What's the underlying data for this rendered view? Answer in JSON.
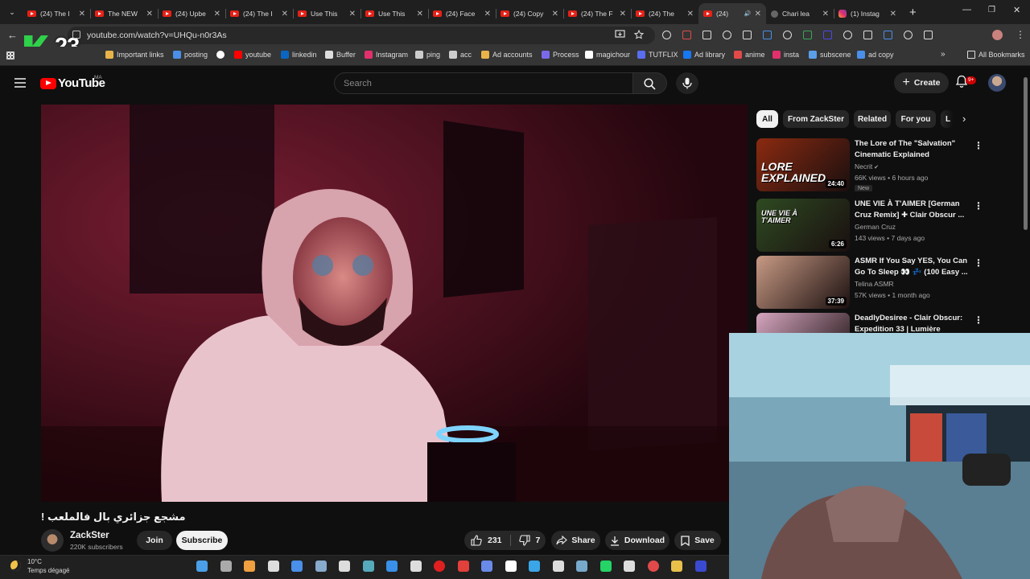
{
  "browser": {
    "tabs": [
      {
        "title": "(24) The I",
        "type": "yt"
      },
      {
        "title": "The NEW",
        "type": "yt"
      },
      {
        "title": "(24) Upbe",
        "type": "yt"
      },
      {
        "title": "(24) The I",
        "type": "yt"
      },
      {
        "title": "Use This",
        "type": "yt"
      },
      {
        "title": "Use This",
        "type": "yt"
      },
      {
        "title": "(24) Face",
        "type": "yt"
      },
      {
        "title": "(24) Copy",
        "type": "yt"
      },
      {
        "title": "(24) The F",
        "type": "yt"
      },
      {
        "title": "(24) The ",
        "type": "yt"
      },
      {
        "title": "(24)",
        "type": "yt",
        "active": true
      },
      {
        "title": "Chari lea",
        "type": "ch"
      },
      {
        "title": "(1) Instag",
        "type": "ig"
      }
    ],
    "url": "youtube.com/watch?v=UHQu-n0r3As",
    "overlay_number": "23",
    "bookmarks": [
      {
        "label": "Important links",
        "color": "#e8b44a"
      },
      {
        "label": "posting",
        "color": "#4a8fe8"
      },
      {
        "label": "",
        "color": "#ffffff"
      },
      {
        "label": "youtube",
        "color": "#ff0000"
      },
      {
        "label": "linkedin",
        "color": "#0a66c2"
      },
      {
        "label": "Buffer",
        "color": "#dddddd"
      },
      {
        "label": "Instagram",
        "color": "#e1306c"
      },
      {
        "label": "ping",
        "color": "#cccccc"
      },
      {
        "label": "acc",
        "color": "#cccccc"
      },
      {
        "label": "Ad accounts",
        "color": "#e8b44a"
      },
      {
        "label": "Process",
        "color": "#7a6ae8"
      },
      {
        "label": "magichour",
        "color": "#ffffff"
      },
      {
        "label": "TUTFLIX",
        "color": "#5a6ef0"
      },
      {
        "label": "Ad library",
        "color": "#1877f2"
      },
      {
        "label": "anime",
        "color": "#e24a4a"
      },
      {
        "label": "insta",
        "color": "#e1306c"
      },
      {
        "label": "subscene",
        "color": "#5a9fe8"
      },
      {
        "label": "ad copy",
        "color": "#4a8fe8"
      }
    ],
    "all_bookmarks": "All Bookmarks"
  },
  "youtube": {
    "logo_text": "YouTube",
    "country_code": "MA",
    "search_placeholder": "Search",
    "create_label": "Create",
    "notif_badge": "9+"
  },
  "video": {
    "title": "! مشجع جزائري بال فالملعب",
    "channel": "ZackSter",
    "subscribers": "220K subscribers",
    "join_label": "Join",
    "subscribe_label": "Subscribe",
    "likes": "231",
    "dislikes": "7",
    "share_label": "Share",
    "download_label": "Download",
    "save_label": "Save"
  },
  "chips": [
    "All",
    "From ZackSter",
    "Related",
    "For you",
    "L"
  ],
  "related": [
    {
      "title": "The Lore of The \"Salvation\" Cinematic Explained",
      "channel": "Necrit",
      "verified": true,
      "views": "66K views • 6 hours ago",
      "duration": "24:40",
      "badge": "New",
      "thumb_text": "LORE EXPLAINED",
      "color": "#8b2a10"
    },
    {
      "title": "UNE VIE À T'AIMER [German Cruz Remix] ✚ Clair Obscur ...",
      "channel": "German Cruz",
      "verified": false,
      "views": "143 views • 7 days ago",
      "duration": "6:26",
      "thumb_text": "UNE VIE À T'AIMER",
      "color": "#2e4a22"
    },
    {
      "title": "ASMR If You Say YES, You Can Go To Sleep 👀 💤 (100 Easy ...",
      "channel": "Telina ASMR",
      "verified": false,
      "views": "57K views • 1 month ago",
      "duration": "37:39",
      "thumb_text": "",
      "color": "#c89a84"
    },
    {
      "title": "DeadlyDesiree - Clair Obscur: Expedition 33 | Lumière (Metal...",
      "channel": "",
      "verified": false,
      "views": "",
      "duration": "",
      "thumb_text": "",
      "color": "#d6a6c0"
    }
  ],
  "taskbar": {
    "temperature": "10°C",
    "weather": "Temps dégagé"
  }
}
